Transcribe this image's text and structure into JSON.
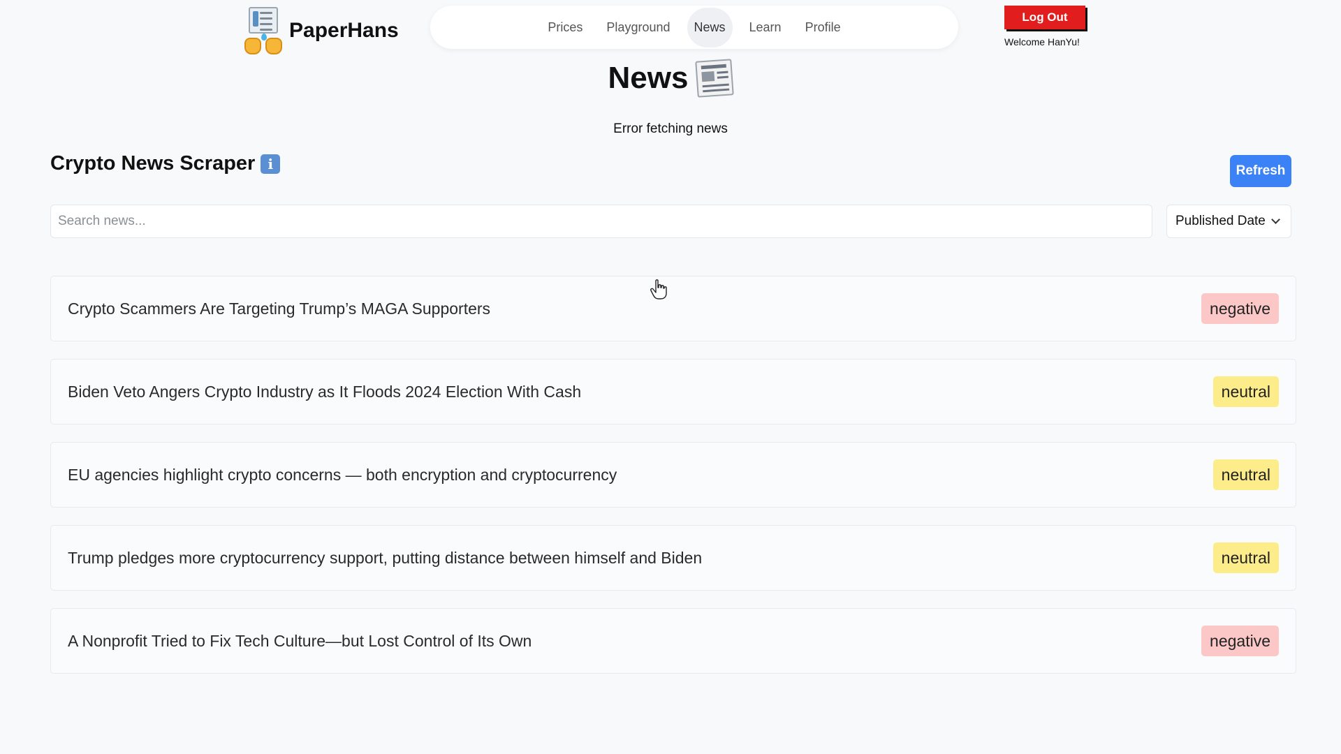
{
  "brand": {
    "name": "PaperHans"
  },
  "nav": {
    "items": [
      {
        "label": "Prices",
        "active": false
      },
      {
        "label": "Playground",
        "active": false
      },
      {
        "label": "News",
        "active": true
      },
      {
        "label": "Learn",
        "active": false
      },
      {
        "label": "Profile",
        "active": false
      }
    ]
  },
  "auth": {
    "logout_label": "Log Out",
    "welcome": "Welcome HanYu!"
  },
  "page": {
    "title": "News",
    "title_icon": "newspaper-icon",
    "error": "Error fetching news"
  },
  "scraper": {
    "title": "Crypto News Scraper",
    "info_icon": "info-icon",
    "refresh_label": "Refresh",
    "search_placeholder": "Search news...",
    "search_value": "",
    "sort_selected": "Published Date"
  },
  "colors": {
    "negative_badge": "#fbc7c7",
    "neutral_badge": "#fcec8a",
    "refresh_button": "#3b82f6",
    "logout_button": "#e11d1d"
  },
  "news": [
    {
      "title": "Crypto Scammers Are Targeting Trump’s MAGA Supporters",
      "sentiment": "negative"
    },
    {
      "title": "Biden Veto Angers Crypto Industry as It Floods 2024 Election With Cash",
      "sentiment": "neutral"
    },
    {
      "title": "EU agencies highlight crypto concerns — both encryption and cryptocurrency",
      "sentiment": "neutral"
    },
    {
      "title": "Trump pledges more cryptocurrency support, putting distance between himself and Biden",
      "sentiment": "neutral"
    },
    {
      "title": "A Nonprofit Tried to Fix Tech Culture—but Lost Control of Its Own",
      "sentiment": "negative"
    }
  ]
}
